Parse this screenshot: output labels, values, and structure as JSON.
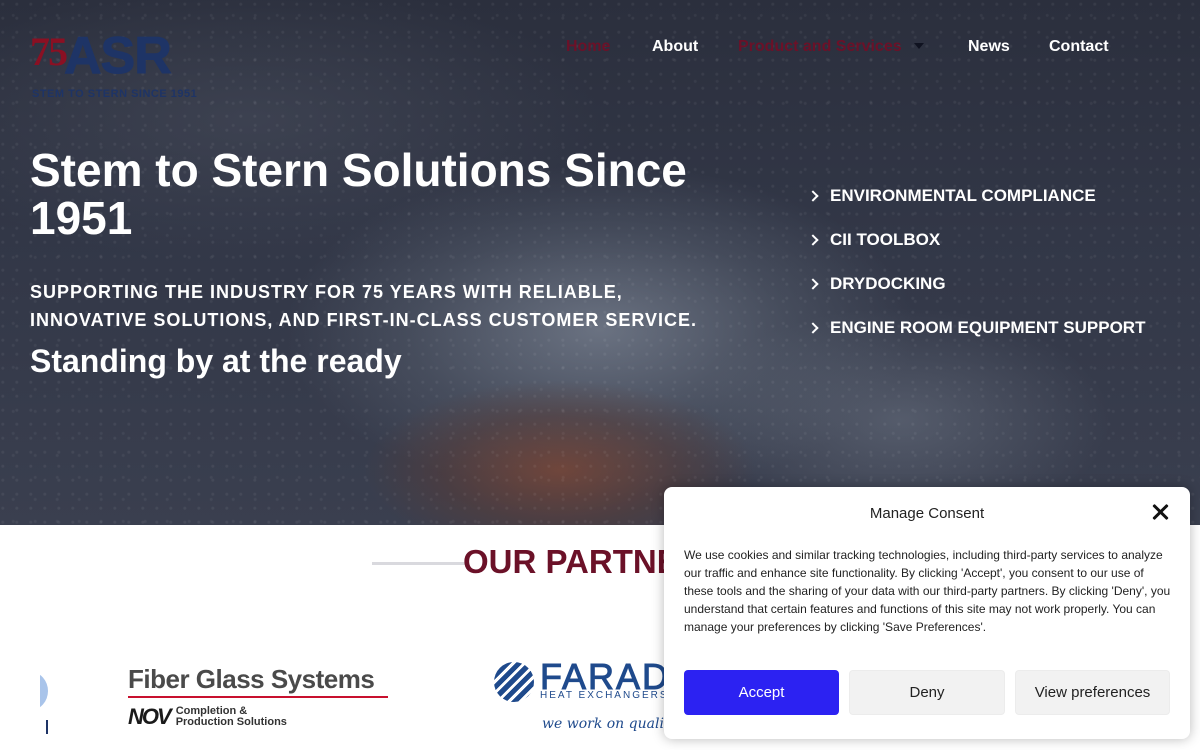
{
  "logo": {
    "badge": "75",
    "name": "ASR",
    "tagline": "STEM TO STERN SINCE 1951"
  },
  "nav": {
    "home": "Home",
    "about": "About",
    "products": "Product and Services",
    "news": "News",
    "contact": "Contact"
  },
  "hero": {
    "title": "Stem to Stern Solutions Since 1951",
    "subtitle": "SUPPORTING THE INDUSTRY FOR 75 YEARS WITH RELIABLE, INNOVATIVE SOLUTIONS, AND FIRST-IN-CLASS CUSTOMER SERVICE.",
    "ready": "Standing by at the ready",
    "links": [
      "ENVIRONMENTAL COMPLIANCE",
      "CII TOOLBOX",
      "DRYDOCKING",
      "ENGINE ROOM EQUIPMENT SUPPORT"
    ]
  },
  "partners": {
    "title": "OUR PARTNERS",
    "fgs": {
      "name": "Fiber Glass Systems",
      "brand": "NOV",
      "sub_line1": "Completion &",
      "sub_line2": "Production Solutions"
    },
    "faraday": {
      "name": "FARADAY",
      "sub": "HEAT EXCHANGERS",
      "tag": "we work on quality"
    }
  },
  "consent": {
    "title": "Manage Consent",
    "body": "We use cookies and similar tracking technologies, including third-party services to analyze our traffic and enhance site functionality. By clicking 'Accept', you consent to our use of these tools and the sharing of your data with our third-party partners. By clicking 'Deny', you understand that certain features and functions of this site may not work properly. You can manage your preferences by clicking 'Save Preferences'.",
    "accept": "Accept",
    "deny": "Deny",
    "view": "View preferences"
  },
  "colors": {
    "brand_maroon": "#6b1128",
    "brand_navy": "#1e3466",
    "accept_button": "#2c22f2"
  }
}
